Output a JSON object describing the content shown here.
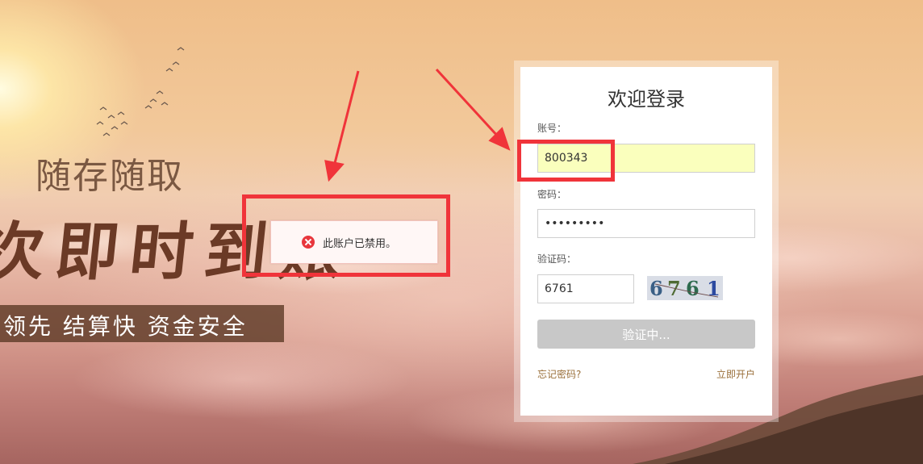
{
  "banner": {
    "slogan_top": "随存随取",
    "slogan_big": "次即时到账",
    "slogan_strip": "领先  结算快  资金安全"
  },
  "toast": {
    "icon": "error-icon",
    "message": "此账户已禁用。"
  },
  "login": {
    "title": "欢迎登录",
    "account_label": "账号：",
    "account_value": "800343",
    "password_label": "密码：",
    "password_value": "123456789",
    "captcha_label": "验证码：",
    "captcha_value": "6761",
    "captcha_image_text": [
      "6",
      "7",
      "6",
      "1"
    ],
    "submit_label": "验证中...",
    "forgot_link": "忘记密码?",
    "register_link": "立即开户"
  },
  "colors": {
    "annotation_red": "#f0343a",
    "link_color": "#9a6f3a",
    "autofill_yellow": "#faffbd",
    "button_disabled": "#c8c8c8"
  }
}
